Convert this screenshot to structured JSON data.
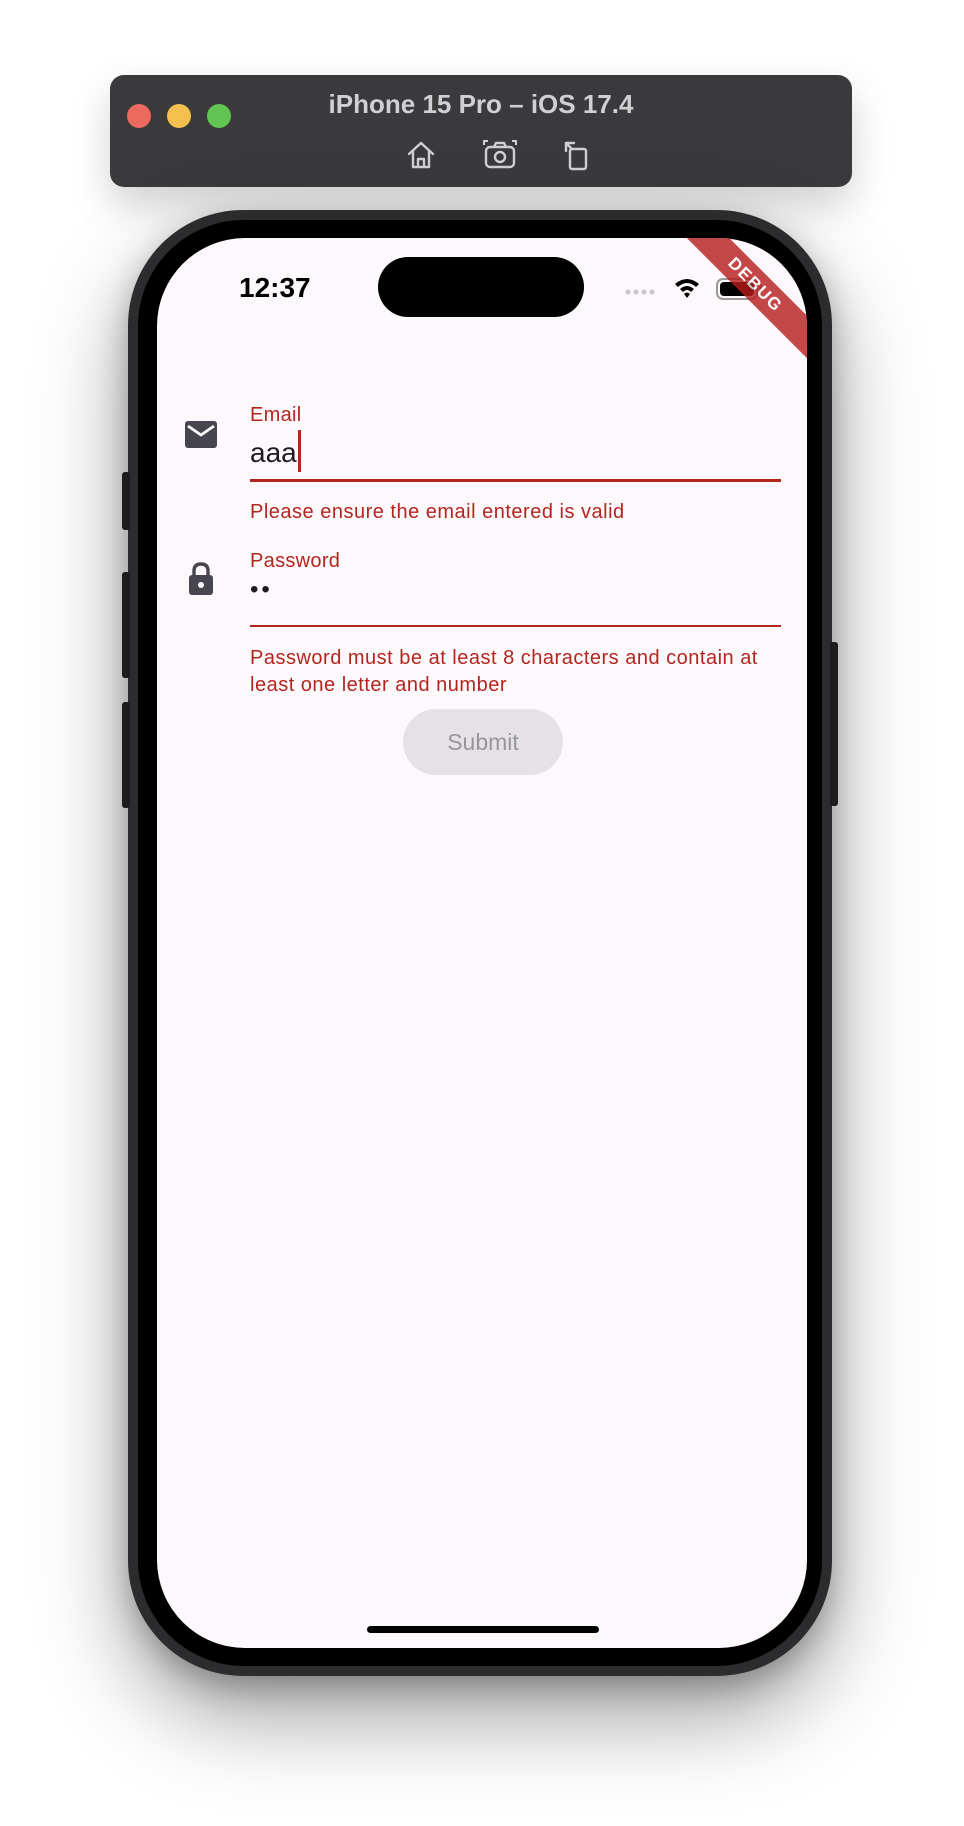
{
  "simulator": {
    "title": "iPhone 15 Pro – iOS 17.4",
    "toolbar_icons": [
      "home-icon",
      "screenshot-icon",
      "rotate-icon"
    ]
  },
  "status_bar": {
    "time": "12:37",
    "icons": [
      "cellular-icon",
      "wifi-icon",
      "battery-icon"
    ]
  },
  "debug_banner": "DEBUG",
  "form": {
    "email": {
      "label": "Email",
      "value": "aaa",
      "error": "Please ensure the email entered is valid",
      "icon": "mail-icon"
    },
    "password": {
      "label": "Password",
      "value": "••",
      "error": "Password must be at least 8 characters and contain at least one letter and number",
      "icon": "lock-icon"
    },
    "submit_label": "Submit"
  },
  "colors": {
    "error": "#b3261e",
    "background": "#fcf8fc",
    "button_disabled_bg": "#e4e2e6",
    "button_disabled_text": "#98969b"
  }
}
